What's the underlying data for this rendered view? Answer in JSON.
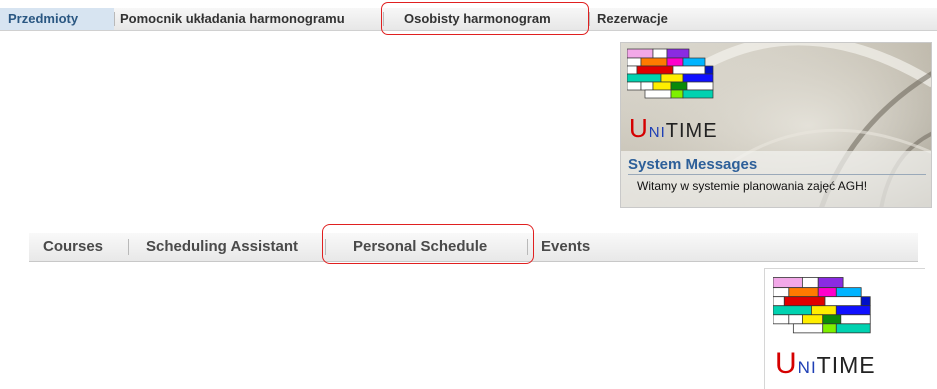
{
  "menu_pl": {
    "items": [
      {
        "label": "Przedmioty",
        "active": true
      },
      {
        "label": "Pomocnik układania harmonogramu",
        "active": false
      },
      {
        "label": "Osobisty harmonogram",
        "active": false,
        "highlighted": true
      },
      {
        "label": "Rezerwacje",
        "active": false
      }
    ]
  },
  "panel": {
    "logo": {
      "u": "U",
      "ni": "NI",
      "time": "TIME"
    },
    "system_messages": {
      "title": "System Messages",
      "text": "Witamy w systemie planowania zajęć AGH!"
    }
  },
  "menu_en": {
    "items": [
      {
        "label": "Courses"
      },
      {
        "label": "Scheduling Assistant"
      },
      {
        "label": "Personal Schedule",
        "highlighted": true
      },
      {
        "label": "Events"
      }
    ]
  },
  "bottom_logo": {
    "u": "U",
    "ni": "NI",
    "time": "TIME"
  },
  "colors": {
    "highlight": "#e02020",
    "menu_active_bg": "#d7e4f1",
    "system_messages_title": "#2d5f99"
  },
  "icons": [
    "unitime-logo-grid-icon"
  ]
}
